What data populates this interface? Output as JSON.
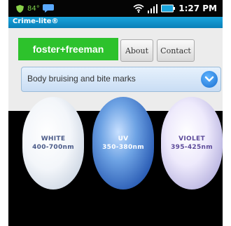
{
  "status_bar": {
    "temperature": "84°",
    "time": "1:27 PM",
    "icons": [
      "shield-icon",
      "chat-bubble-icon",
      "wifi-icon",
      "signal-bars-icon",
      "battery-icon"
    ]
  },
  "app_bar": {
    "title": "Crime-lite®"
  },
  "header": {
    "brand": "foster+freeman",
    "about_label": "About",
    "contact_label": "Contact"
  },
  "selector": {
    "value": "Body bruising and bite marks"
  },
  "lights": [
    {
      "name": "WHITE",
      "range": "400-700nm"
    },
    {
      "name": "UV",
      "range": "350-380nm"
    },
    {
      "name": "VIOLET",
      "range": "395-425nm"
    }
  ],
  "colors": {
    "brand_green": "#2dc22c",
    "app_bar_blue": "#1aa4dc",
    "dropdown_button_blue": "#1b6fd0"
  }
}
